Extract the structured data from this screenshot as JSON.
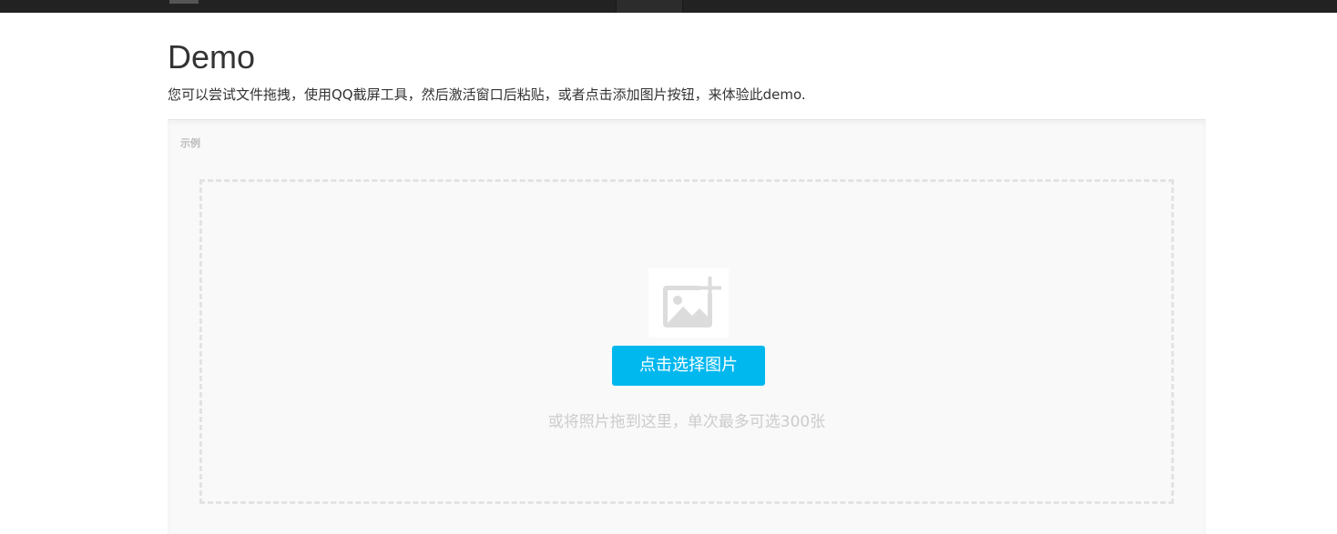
{
  "header": {
    "title": "Demo",
    "description": "您可以尝试文件拖拽，使用QQ截屏工具，然后激活窗口后粘贴，或者点击添加图片按钮，来体验此demo."
  },
  "panel": {
    "label": "示例"
  },
  "uploader": {
    "icon": "image-add-icon",
    "button_label": "点击选择图片",
    "hint": "或将照片拖到这里，单次最多可选300张"
  },
  "colors": {
    "accent": "#00b7ee",
    "topbar": "#222222",
    "hint_text": "#cccccc"
  }
}
